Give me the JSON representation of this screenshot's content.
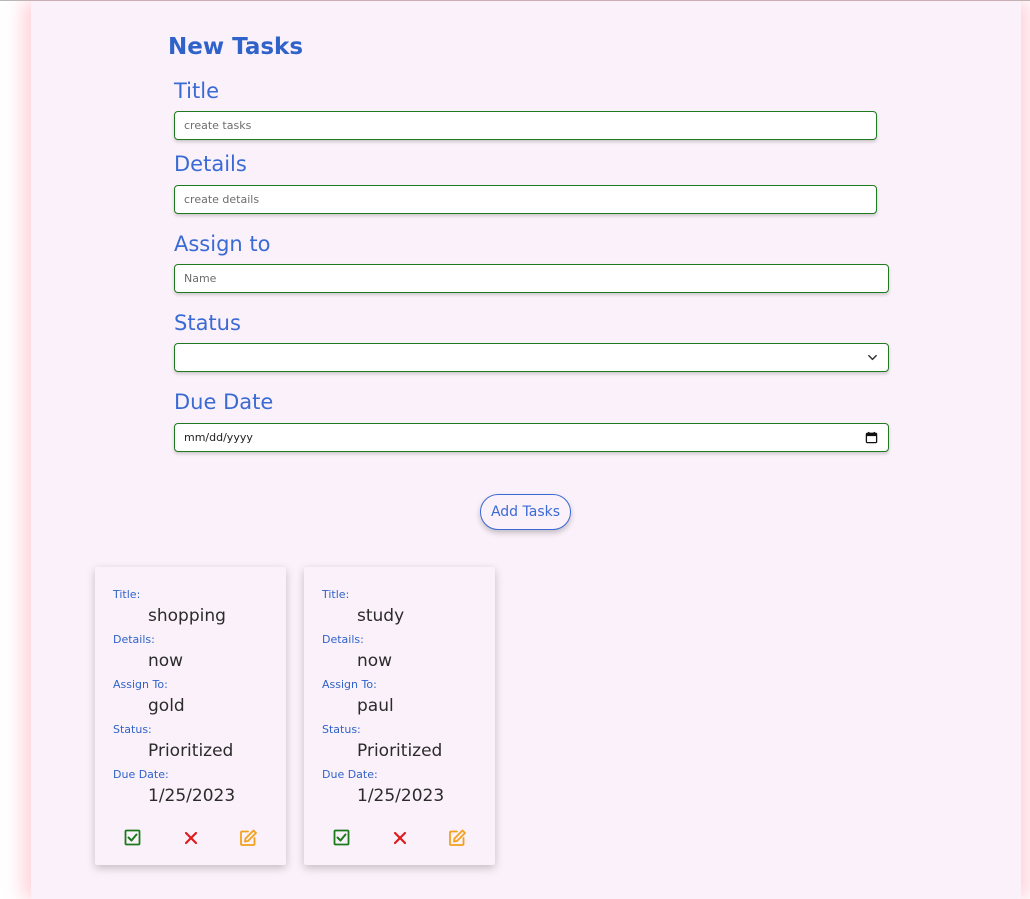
{
  "form": {
    "title": "New Tasks",
    "title_label": "Title",
    "title_placeholder": "create tasks",
    "details_label": "Details",
    "details_placeholder": "create details",
    "assign_label": "Assign to",
    "assign_placeholder": "Name",
    "status_label": "Status",
    "status_value": "",
    "due_label": "Due Date",
    "due_placeholder": "mm/dd/yyyy",
    "submit_label": "Add Tasks"
  },
  "card_labels": {
    "title": "Title:",
    "details": "Details:",
    "assign": "Assign To:",
    "status": "Status:",
    "due": "Due Date:"
  },
  "tasks": [
    {
      "title": "shopping",
      "details": "now",
      "assign": "gold",
      "status": "Prioritized",
      "due": "1/25/2023"
    },
    {
      "title": "study",
      "details": "now",
      "assign": "paul",
      "status": "Prioritized",
      "due": "1/25/2023"
    }
  ],
  "icons": {
    "complete": "check-square-icon",
    "delete": "x-icon",
    "edit": "edit-icon"
  },
  "colors": {
    "accent": "#3a6ad4",
    "input_border": "#1f7a1f",
    "complete": "#1b7a1b",
    "delete": "#e01b1b",
    "edit": "#f2a11d",
    "background": "#fbf1fa"
  }
}
